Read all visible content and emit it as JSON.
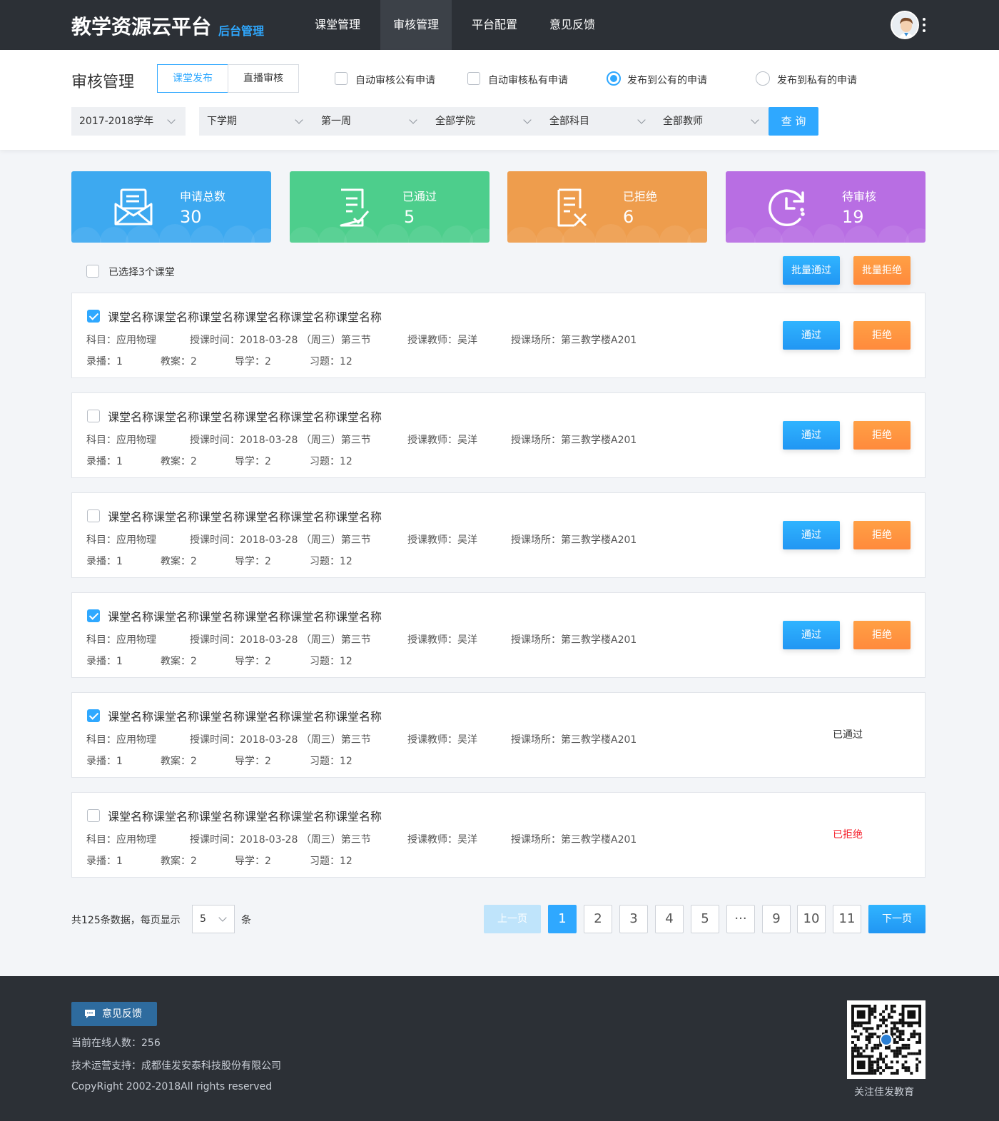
{
  "header": {
    "logo": "教学资源云平台",
    "logo_sub": "后台管理",
    "nav": [
      "课堂管理",
      "审核管理",
      "平台配置",
      "意见反馈"
    ],
    "active_nav": "审核管理"
  },
  "filters": {
    "page_title": "审核管理",
    "tabs": [
      "课堂发布",
      "直播审核"
    ],
    "active_tab": "课堂发布",
    "options": {
      "auto_public": {
        "label": "自动审核公有申请",
        "checked": false
      },
      "auto_private": {
        "label": "自动审核私有申请",
        "checked": false
      },
      "publish_public": {
        "label": "发布到公有的申请",
        "selected": true
      },
      "publish_private": {
        "label": "发布到私有的申请",
        "selected": false
      }
    },
    "selects": [
      "2017-2018学年",
      "下学期",
      "第一周",
      "全部学院",
      "全部科目",
      "全部教师"
    ],
    "query_label": "查 询"
  },
  "stats": [
    {
      "label": "申请总数",
      "value": "30",
      "color": "#3da9f0",
      "icon": "mail-icon"
    },
    {
      "label": "已通过",
      "value": "5",
      "color": "#4dce8c",
      "icon": "approved-doc-icon"
    },
    {
      "label": "已拒绝",
      "value": "6",
      "color": "#ee9d4d",
      "icon": "rejected-doc-icon"
    },
    {
      "label": "待审核",
      "value": "19",
      "color": "#b86ee3",
      "icon": "clock-icon"
    }
  ],
  "batch": {
    "selected_label": "已选择3个课堂",
    "approve_all": "批量通过",
    "reject_all": "批量拒绝"
  },
  "course_labels": {
    "subject": "科目：",
    "time": "授课时间：",
    "teacher": "授课教师：",
    "location": "授课场所：",
    "recording": "录播：",
    "lesson_plan": "教案：",
    "guide": "导学：",
    "exercise": "习题：",
    "approve": "通过",
    "reject": "拒绝"
  },
  "courses": [
    {
      "title": "课堂名称课堂名称课堂名称课堂名称课堂名称课堂名称",
      "checked": true,
      "subject": "应用物理",
      "time": "2018-03-28 （周三）第三节",
      "teacher": "吴洋",
      "location": "第三教学楼A201",
      "recording": "1",
      "lesson_plan": "2",
      "guide": "2",
      "exercise": "12",
      "status": "pending"
    },
    {
      "title": "课堂名称课堂名称课堂名称课堂名称课堂名称课堂名称",
      "checked": false,
      "subject": "应用物理",
      "time": "2018-03-28 （周三）第三节",
      "teacher": "吴洋",
      "location": "第三教学楼A201",
      "recording": "1",
      "lesson_plan": "2",
      "guide": "2",
      "exercise": "12",
      "status": "pending"
    },
    {
      "title": "课堂名称课堂名称课堂名称课堂名称课堂名称课堂名称",
      "checked": false,
      "subject": "应用物理",
      "time": "2018-03-28 （周三）第三节",
      "teacher": "吴洋",
      "location": "第三教学楼A201",
      "recording": "1",
      "lesson_plan": "2",
      "guide": "2",
      "exercise": "12",
      "status": "pending"
    },
    {
      "title": "课堂名称课堂名称课堂名称课堂名称课堂名称课堂名称",
      "checked": true,
      "subject": "应用物理",
      "time": "2018-03-28 （周三）第三节",
      "teacher": "吴洋",
      "location": "第三教学楼A201",
      "recording": "1",
      "lesson_plan": "2",
      "guide": "2",
      "exercise": "12",
      "status": "pending"
    },
    {
      "title": "课堂名称课堂名称课堂名称课堂名称课堂名称课堂名称",
      "checked": true,
      "subject": "应用物理",
      "time": "2018-03-28 （周三）第三节",
      "teacher": "吴洋",
      "location": "第三教学楼A201",
      "recording": "1",
      "lesson_plan": "2",
      "guide": "2",
      "exercise": "12",
      "status": "approved",
      "status_text": "已通过"
    },
    {
      "title": "课堂名称课堂名称课堂名称课堂名称课堂名称课堂名称",
      "checked": false,
      "subject": "应用物理",
      "time": "2018-03-28 （周三）第三节",
      "teacher": "吴洋",
      "location": "第三教学楼A201",
      "recording": "1",
      "lesson_plan": "2",
      "guide": "2",
      "exercise": "12",
      "status": "rejected",
      "status_text": "已拒绝"
    }
  ],
  "pagination": {
    "total_text": "共125条数据，每页显示",
    "page_size": "5",
    "unit": "条",
    "prev": "上一页",
    "next": "下一页",
    "pages": [
      "1",
      "2",
      "3",
      "4",
      "5",
      "···",
      "9",
      "10",
      "11"
    ],
    "current": "1"
  },
  "footer": {
    "feedback": "意见反馈",
    "online": "当前在线人数：256",
    "support": "技术运营支持：成都佳发安泰科技股份有限公司",
    "copyright": "CopyRight 2002-2018All rights reserved",
    "qr_caption": "关注佳发教育"
  },
  "colors": {
    "accent": "#2fa8ff",
    "orange": "#ff8a3c",
    "rejected_text": "#f5222d",
    "nav_bg": "#2c3036"
  }
}
